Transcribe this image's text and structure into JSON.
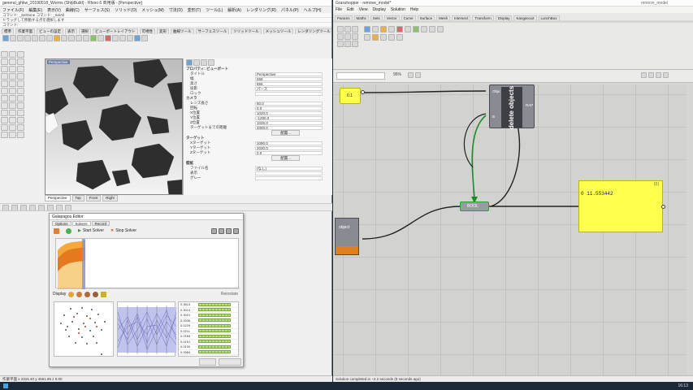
{
  "rhino": {
    "title": "general_ghkw_20190518_Worms (ShipBuild) - Rhino 6 商用版 - [Perspective]",
    "menu": [
      "ファイル(F)",
      "編集(E)",
      "表示(V)",
      "曲線(C)",
      "サーフェス(S)",
      "ソリッド(O)",
      "メッシュ(M)",
      "寸法(D)",
      "変形(T)",
      "ツール(L)",
      "解析(A)",
      "レンダリング(R)",
      "パネル(P)",
      "ヘルプ(H)"
    ],
    "cmd1": "コマンド: _SelNone コマンド: _SelAll",
    "cmd2": "ドラッグして移動する点を選択します",
    "cmd3": "コマンド:",
    "tabs": [
      "標準",
      "作業平面",
      "ビューの設定",
      "表示",
      "選択",
      "ビューポートレイアウト",
      "可視性",
      "変形",
      "曲線ツール",
      "サーフェスツール",
      "ソリッドツール",
      "メッシュツール",
      "レンダリングツール"
    ],
    "viewport_label": "Perspective",
    "viewport_tabs": [
      "Perspective",
      "Top",
      "Front",
      "Right"
    ],
    "props": {
      "header": "プロパティ: ビューポート",
      "rows": [
        {
          "k": "タイトル",
          "v": "Perspective"
        },
        {
          "k": "幅",
          "v": "555"
        },
        {
          "k": "高さ",
          "v": "555"
        },
        {
          "k": "投影",
          "v": "パース"
        },
        {
          "k": "ロック",
          "v": ""
        }
      ],
      "camera_header": "カメラ",
      "camera_rows": [
        {
          "k": "レンズ長さ",
          "v": "50.0"
        },
        {
          "k": "回転",
          "v": "0.0"
        },
        {
          "k": "X位置",
          "v": "1020.0"
        },
        {
          "k": "Y位置",
          "v": "-1290.0"
        },
        {
          "k": "Z位置",
          "v": "1026.0"
        },
        {
          "k": "ターゲットまでの距離",
          "v": "4000.0"
        }
      ],
      "target_header": "ターゲット",
      "target_rows": [
        {
          "k": "Xターゲット",
          "v": "1090.0"
        },
        {
          "k": "Yターゲット",
          "v": "2030.0"
        },
        {
          "k": "Zターゲット",
          "v": "0.0"
        }
      ],
      "wallpaper_header": "壁紙",
      "wallpaper_rows": [
        {
          "k": "ファイル名",
          "v": "(なし)"
        },
        {
          "k": "表示",
          "v": ""
        },
        {
          "k": "グレー",
          "v": ""
        }
      ],
      "place_label": "配置...",
      "place_label2": "配置..."
    },
    "status": "作業平面 x 2315.40 y 4561.85 z 0.00"
  },
  "optimizer": {
    "title": "Galapagos Editor",
    "tabs": [
      "Options",
      "Solvers",
      "Record"
    ],
    "start_label": "Start Solver",
    "stop_label": "Stop Solver",
    "display_label": "Display",
    "reinstate_label": "Reinstate",
    "genes": [
      {
        "name": "0.3613",
        "fill": 0.9
      },
      {
        "name": "0.3013",
        "fill": 0.9
      },
      {
        "name": "0.3001",
        "fill": 0.9
      },
      {
        "name": "0.0536",
        "fill": 0.9
      },
      {
        "name": "0.0229",
        "fill": 0.9
      },
      {
        "name": "0.0211",
        "fill": 0.9
      },
      {
        "name": "0.0183",
        "fill": 0.9
      },
      {
        "name": "0.0151",
        "fill": 0.9
      },
      {
        "name": "0.0100",
        "fill": 0.9
      },
      {
        "name": "0.0084",
        "fill": 0.9
      },
      {
        "name": "0.0041",
        "fill": 0.9
      }
    ],
    "ok_label": "OK",
    "cancel_label": "Cancel"
  },
  "grasshopper": {
    "title": "Grasshopper - remove_model*",
    "title_right": "remove_model",
    "menu": [
      "File",
      "Edit",
      "View",
      "Display",
      "Solution",
      "Help"
    ],
    "tabs": [
      "Params",
      "Maths",
      "Sets",
      "Vector",
      "Curve",
      "Surface",
      "Mesh",
      "Intersect",
      "Transform",
      "Display",
      "Kangaroo2",
      "LunchBox"
    ],
    "zoom": "95%",
    "slider_value": "0.1",
    "delete_component": {
      "label": "delete objects",
      "input_top": "Objs",
      "input_bottom": "B",
      "output": "RAP"
    },
    "bottom_component": {
      "label": "object"
    },
    "relay_label": "BOOL",
    "panel_header": "{0}",
    "panel_value": "0 11.553442",
    "status": "Solution completed in ~2.2 seconds (8 seconds ago)",
    "accent_wire": "#1a8c2a"
  },
  "taskbar": {
    "time": "16:13"
  }
}
